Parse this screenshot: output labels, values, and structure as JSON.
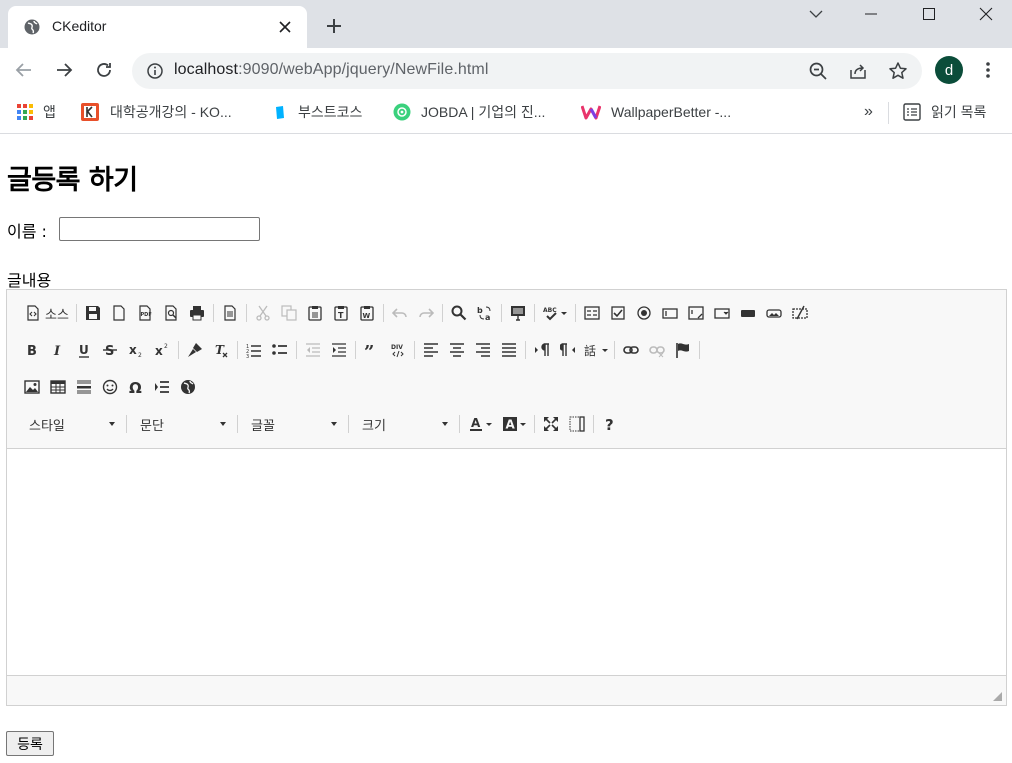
{
  "browser": {
    "tab_title": "CKeditor",
    "url_host": "localhost",
    "url_rest": ":9090/webApp/jquery/NewFile.html",
    "profile_initial": "d",
    "bookmarks": [
      {
        "label": "앱",
        "icon": "apps-grid-icon"
      },
      {
        "label": "대학공개강의 - KO...",
        "icon": "kocw-icon"
      },
      {
        "label": "부스트코스",
        "icon": "boostcourse-icon"
      },
      {
        "label": "JOBDA | 기업의 진...",
        "icon": "jobda-icon"
      },
      {
        "label": "WallpaperBetter -...",
        "icon": "wallpaperbetter-icon"
      }
    ],
    "more_bookmarks": "»",
    "reading_list": "읽기 목록"
  },
  "page": {
    "heading": "글등록 하기",
    "name_label": "이름 :",
    "name_value": "",
    "content_label": "글내용",
    "submit_label": "등록"
  },
  "editor": {
    "source_label": "소스",
    "combos": {
      "style": "스타일",
      "format": "문단",
      "font": "글꼴",
      "size": "크기"
    },
    "body_text": ""
  },
  "colors": {
    "tabstrip": "#dee1e6",
    "avatar": "#0b4d3a",
    "toolbar_bg": "#f8f8f8",
    "border": "#d1d1d1"
  }
}
